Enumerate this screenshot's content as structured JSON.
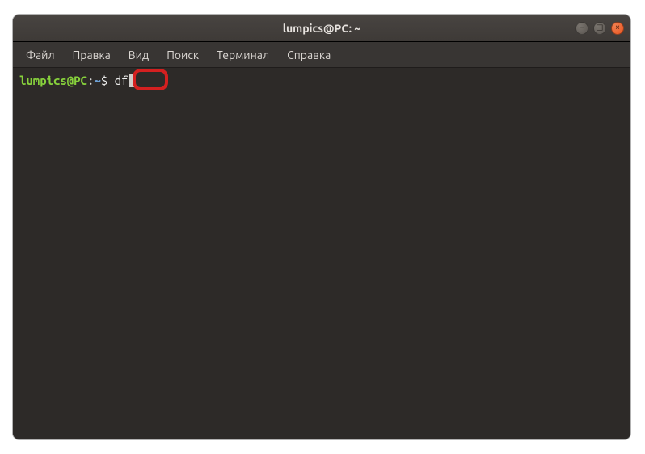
{
  "window": {
    "title": "lumpics@PC: ~"
  },
  "menubar": {
    "items": [
      {
        "label": "Файл"
      },
      {
        "label": "Правка"
      },
      {
        "label": "Вид"
      },
      {
        "label": "Поиск"
      },
      {
        "label": "Терминал"
      },
      {
        "label": "Справка"
      }
    ]
  },
  "prompt": {
    "user_host": "lumpics@PC",
    "separator": ":",
    "path": "~",
    "symbol": "$",
    "command": "df"
  },
  "controls": {
    "minimize_glyph": "–",
    "maximize_glyph": "◻",
    "close_glyph": "×"
  },
  "colors": {
    "prompt_user": "#87d13c",
    "prompt_path": "#6ea0d4",
    "close_button": "#e95420",
    "highlight": "#d42020"
  }
}
